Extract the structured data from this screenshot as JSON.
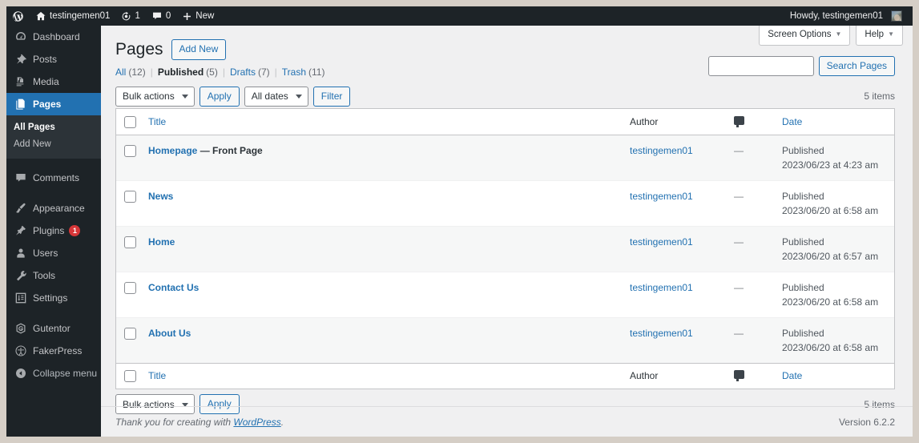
{
  "adminbar": {
    "wp_logo": "wordpress-logo-icon",
    "site_name": "testingemen01",
    "updates_count": "1",
    "comments_count": "0",
    "new_label": "New",
    "howdy": "Howdy, testingemen01"
  },
  "sidebar": {
    "items": [
      {
        "label": "Dashboard",
        "icon": "dashboard-icon",
        "name": "dashboard"
      },
      {
        "label": "Posts",
        "icon": "pin-icon",
        "name": "posts"
      },
      {
        "label": "Media",
        "icon": "media-icon",
        "name": "media"
      },
      {
        "label": "Pages",
        "icon": "pages-icon",
        "name": "pages",
        "current": true
      },
      {
        "label": "Comments",
        "icon": "comment-icon",
        "name": "comments"
      },
      {
        "label": "Appearance",
        "icon": "brush-icon",
        "name": "appearance"
      },
      {
        "label": "Plugins",
        "icon": "plugin-icon",
        "name": "plugins",
        "badge": "1"
      },
      {
        "label": "Users",
        "icon": "user-icon",
        "name": "users"
      },
      {
        "label": "Tools",
        "icon": "wrench-icon",
        "name": "tools"
      },
      {
        "label": "Settings",
        "icon": "settings-icon",
        "name": "settings"
      },
      {
        "label": "Gutentor",
        "icon": "gutentor-icon",
        "name": "gutentor"
      },
      {
        "label": "FakerPress",
        "icon": "fakerpress-icon",
        "name": "fakerpress"
      },
      {
        "label": "Collapse menu",
        "icon": "collapse-icon",
        "name": "collapse-menu"
      }
    ],
    "submenu": [
      {
        "label": "All Pages",
        "current": true
      },
      {
        "label": "Add New",
        "current": false
      }
    ]
  },
  "screen_meta": {
    "screen_options": "Screen Options",
    "help": "Help",
    "caret": "▼"
  },
  "header": {
    "title": "Pages",
    "add_new": "Add New"
  },
  "views": [
    {
      "label": "All",
      "count": "(12)",
      "current": false
    },
    {
      "label": "Published",
      "count": "(5)",
      "current": true
    },
    {
      "label": "Drafts",
      "count": "(7)",
      "current": false
    },
    {
      "label": "Trash",
      "count": "(11)",
      "current": false
    }
  ],
  "search": {
    "value": "",
    "placeholder": "",
    "button": "Search Pages"
  },
  "tablenav_top": {
    "bulk_actions": "Bulk actions",
    "apply": "Apply",
    "date_filter": "All dates",
    "filter": "Filter",
    "displaying": "5 items"
  },
  "tablenav_bottom": {
    "bulk_actions": "Bulk actions",
    "apply": "Apply",
    "displaying": "5 items"
  },
  "table": {
    "columns": {
      "title": "Title",
      "author": "Author",
      "comments": "comment-bubble-icon",
      "date": "Date"
    },
    "rows": [
      {
        "title": "Homepage",
        "state": "— Front Page",
        "author": "testingemen01",
        "comments": "—",
        "date_status": "Published",
        "date_value": "2023/06/23 at 4:23 am"
      },
      {
        "title": "News",
        "state": "",
        "author": "testingemen01",
        "comments": "—",
        "date_status": "Published",
        "date_value": "2023/06/20 at 6:58 am"
      },
      {
        "title": "Home",
        "state": "",
        "author": "testingemen01",
        "comments": "—",
        "date_status": "Published",
        "date_value": "2023/06/20 at 6:57 am"
      },
      {
        "title": "Contact Us",
        "state": "",
        "author": "testingemen01",
        "comments": "—",
        "date_status": "Published",
        "date_value": "2023/06/20 at 6:58 am"
      },
      {
        "title": "About Us",
        "state": "",
        "author": "testingemen01",
        "comments": "—",
        "date_status": "Published",
        "date_value": "2023/06/20 at 6:58 am"
      }
    ]
  },
  "footer": {
    "thanks_prefix": "Thank you for creating with ",
    "wordpress_link": "WordPress",
    "thanks_suffix": ".",
    "version": "Version 6.2.2"
  },
  "colors": {
    "admin_dark": "#1d2327",
    "admin_submenu": "#2c3338",
    "accent_blue": "#2271b1",
    "content_bg": "#f0f0f1",
    "page_bg": "#d5cec6",
    "badge_red": "#d63638"
  }
}
